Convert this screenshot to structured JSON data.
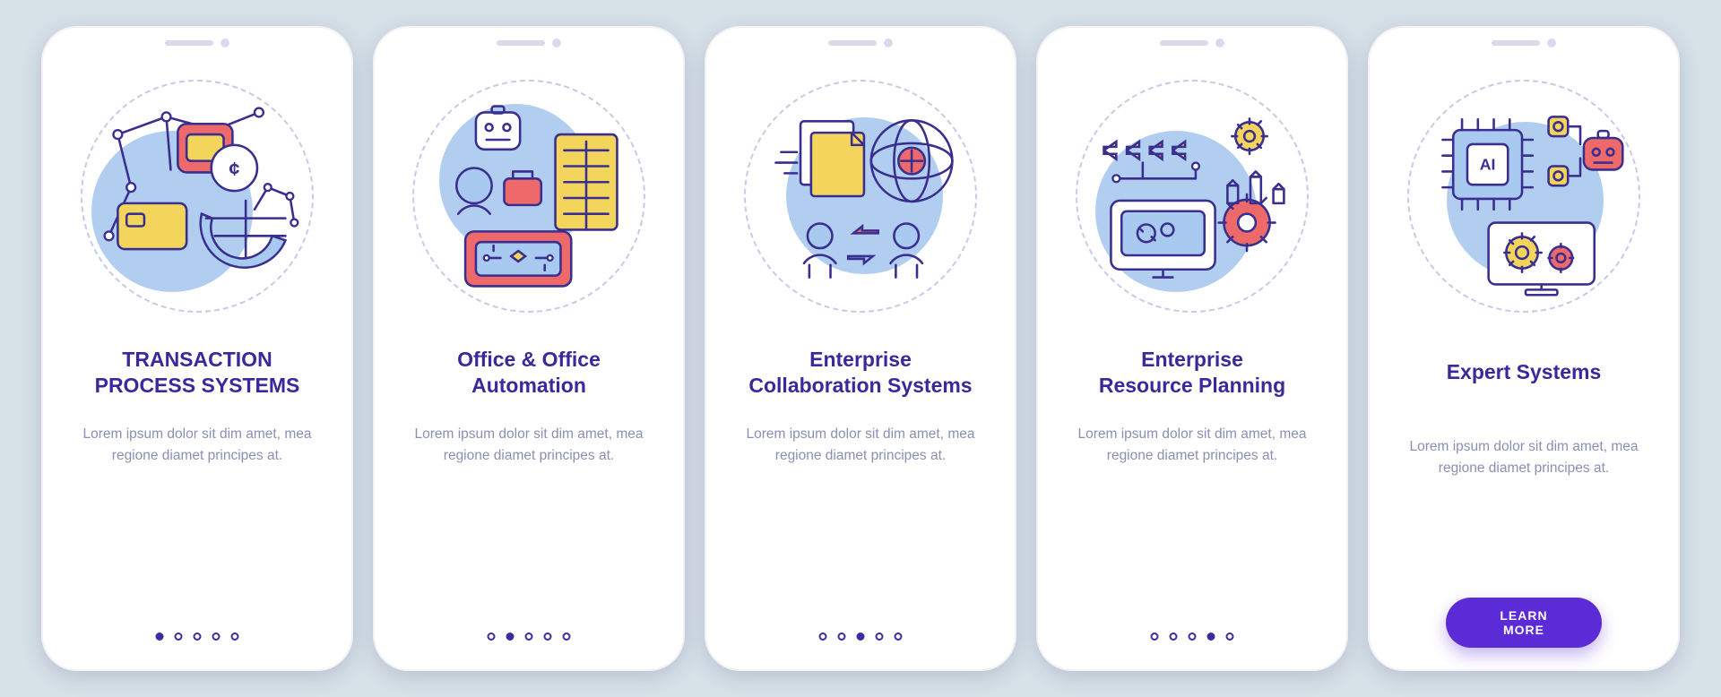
{
  "colors": {
    "brand": "#392a9c",
    "accent": "#5a2bd6",
    "blob": "#a8c9f0",
    "yellow": "#f4d55c",
    "coral": "#ee6a6a"
  },
  "body_text": "Lorem ipsum dolor sit dim amet, mea regione diamet principes at.",
  "cta_label": "LEARN MORE",
  "total_slides": 5,
  "cards": [
    {
      "title": "TRANSACTION\nPROCESS SYSTEMS",
      "icon": "transaction-icon",
      "active_index": 0,
      "has_cta": false
    },
    {
      "title": "Office & Office\nAutomation",
      "icon": "office-automation-icon",
      "active_index": 1,
      "has_cta": false
    },
    {
      "title": "Enterprise\nCollaboration Systems",
      "icon": "collaboration-icon",
      "active_index": 2,
      "has_cta": false
    },
    {
      "title": "Enterprise\nResource Planning",
      "icon": "erp-icon",
      "active_index": 3,
      "has_cta": false
    },
    {
      "title": "Expert Systems",
      "icon": "expert-systems-icon",
      "active_index": 4,
      "has_cta": true
    }
  ]
}
